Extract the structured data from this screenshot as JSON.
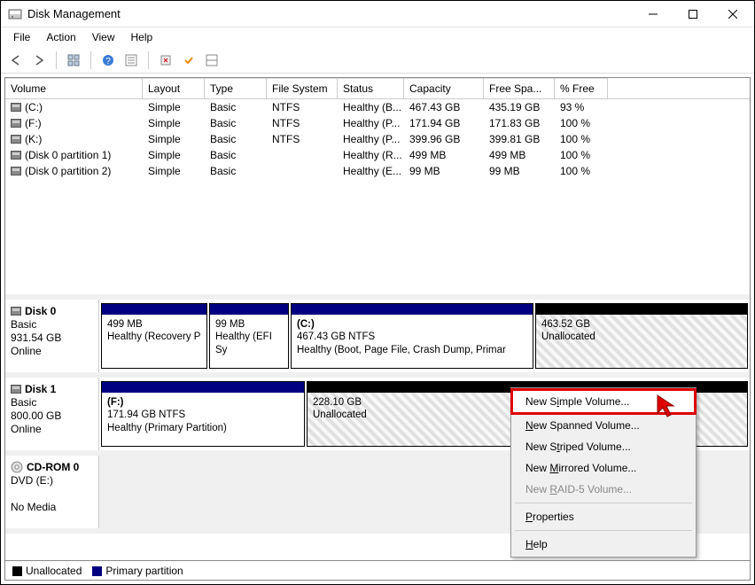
{
  "window": {
    "title": "Disk Management"
  },
  "menubar": {
    "items": [
      "File",
      "Action",
      "View",
      "Help"
    ]
  },
  "table": {
    "headers": [
      "Volume",
      "Layout",
      "Type",
      "File System",
      "Status",
      "Capacity",
      "Free Spa...",
      "% Free"
    ],
    "rows": [
      {
        "vol": "(C:)",
        "layout": "Simple",
        "type": "Basic",
        "fs": "NTFS",
        "status": "Healthy (B...",
        "cap": "467.43 GB",
        "free": "435.19 GB",
        "pct": "93 %"
      },
      {
        "vol": "(F:)",
        "layout": "Simple",
        "type": "Basic",
        "fs": "NTFS",
        "status": "Healthy (P...",
        "cap": "171.94 GB",
        "free": "171.83 GB",
        "pct": "100 %"
      },
      {
        "vol": "(K:)",
        "layout": "Simple",
        "type": "Basic",
        "fs": "NTFS",
        "status": "Healthy (P...",
        "cap": "399.96 GB",
        "free": "399.81 GB",
        "pct": "100 %"
      },
      {
        "vol": "(Disk 0 partition 1)",
        "layout": "Simple",
        "type": "Basic",
        "fs": "",
        "status": "Healthy (R...",
        "cap": "499 MB",
        "free": "499 MB",
        "pct": "100 %"
      },
      {
        "vol": "(Disk 0 partition 2)",
        "layout": "Simple",
        "type": "Basic",
        "fs": "",
        "status": "Healthy (E...",
        "cap": "99 MB",
        "free": "99 MB",
        "pct": "100 %"
      }
    ]
  },
  "disks": {
    "d0": {
      "name": "Disk 0",
      "type": "Basic",
      "size": "931.54 GB",
      "status": "Online",
      "parts": [
        {
          "stripe": "navy",
          "letter": "",
          "line1": "499 MB",
          "line2": "Healthy (Recovery P"
        },
        {
          "stripe": "navy",
          "letter": "",
          "line1": "99 MB",
          "line2": "Healthy (EFI Sy"
        },
        {
          "stripe": "navy",
          "letter": "(C:)",
          "line1": "467.43 GB NTFS",
          "line2": "Healthy (Boot, Page File, Crash Dump, Primar"
        },
        {
          "stripe": "black",
          "letter": "",
          "line1": "463.52 GB",
          "line2": "Unallocated",
          "unalloc": true
        }
      ]
    },
    "d1": {
      "name": "Disk 1",
      "type": "Basic",
      "size": "800.00 GB",
      "status": "Online",
      "parts": [
        {
          "stripe": "navy",
          "letter": "(F:)",
          "line1": "171.94 GB NTFS",
          "line2": "Healthy (Primary Partition)"
        },
        {
          "stripe": "black",
          "letter": "",
          "line1": "228.10 GB",
          "line2": "Unallocated",
          "unalloc": true
        }
      ]
    },
    "cd": {
      "name": "CD-ROM 0",
      "type": "DVD (E:)",
      "size": "",
      "status": "No Media"
    }
  },
  "legend": {
    "unalloc": "Unallocated",
    "primary": "Primary partition"
  },
  "ctxmenu": {
    "items": [
      {
        "label": "New Simple Volume...",
        "highlight": true,
        "u": "i"
      },
      {
        "label": "New Spanned Volume...",
        "u": "n"
      },
      {
        "label": "New Striped Volume...",
        "u": "t"
      },
      {
        "label": "New Mirrored Volume...",
        "u": "M"
      },
      {
        "label": "New RAID-5 Volume...",
        "disabled": true,
        "u": "R"
      }
    ],
    "props": "Properties",
    "help": "Help"
  }
}
